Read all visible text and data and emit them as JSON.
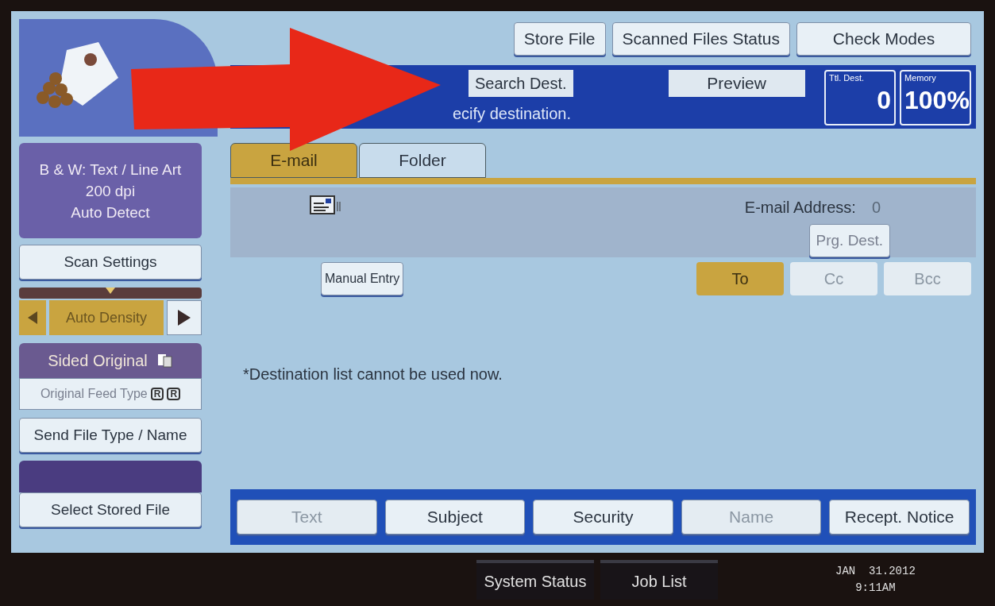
{
  "top_buttons": [
    {
      "label": "Store File"
    },
    {
      "label": "Scanned Files Status"
    },
    {
      "label": "Check Modes"
    }
  ],
  "header": {
    "search_button": "Search Dest.",
    "preview_button": "Preview",
    "message": "ecify destination.",
    "total_dest": {
      "label": "Ttl. Dest.",
      "value": "0"
    },
    "memory": {
      "label": "Memory",
      "value": "100%"
    }
  },
  "scan_info": [
    "B & W: Text / Line Art",
    "200 dpi",
    "Auto Detect"
  ],
  "sidebar": [
    {
      "kind": "button",
      "label": "Scan Settings"
    },
    {
      "kind": "density",
      "label": "Auto Density",
      "level": 0.5
    },
    {
      "kind": "panel",
      "label": "Sided Original"
    },
    {
      "kind": "feed",
      "label": "Original Feed Type",
      "badges": [
        "R",
        "R"
      ]
    },
    {
      "kind": "button",
      "label": "Send File Type / Name"
    },
    {
      "kind": "empty"
    },
    {
      "kind": "button",
      "label": "Select Stored File"
    }
  ],
  "tabs": [
    {
      "label": "E-mail",
      "selected": true
    },
    {
      "label": "Folder",
      "selected": false
    }
  ],
  "address": {
    "label": "E-mail Address:",
    "count": "0",
    "program_button": "Prg. Dest."
  },
  "manual_entry": "Manual Entry",
  "recipient_types": [
    {
      "label": "To",
      "selected": true,
      "disabled": false
    },
    {
      "label": "Cc",
      "selected": false,
      "disabled": true
    },
    {
      "label": "Bcc",
      "selected": false,
      "disabled": true
    }
  ],
  "notice": "*Destination list cannot be used now.",
  "footer_buttons": [
    {
      "label": "Text",
      "disabled": true
    },
    {
      "label": "Subject",
      "disabled": false
    },
    {
      "label": "Security",
      "disabled": false
    },
    {
      "label": "Name",
      "disabled": true
    },
    {
      "label": "Recept. Notice",
      "disabled": false
    }
  ],
  "status_bar": {
    "buttons": [
      "System Status",
      "Job List"
    ],
    "date": "JAN  31.2012",
    "time": "9:11AM"
  }
}
